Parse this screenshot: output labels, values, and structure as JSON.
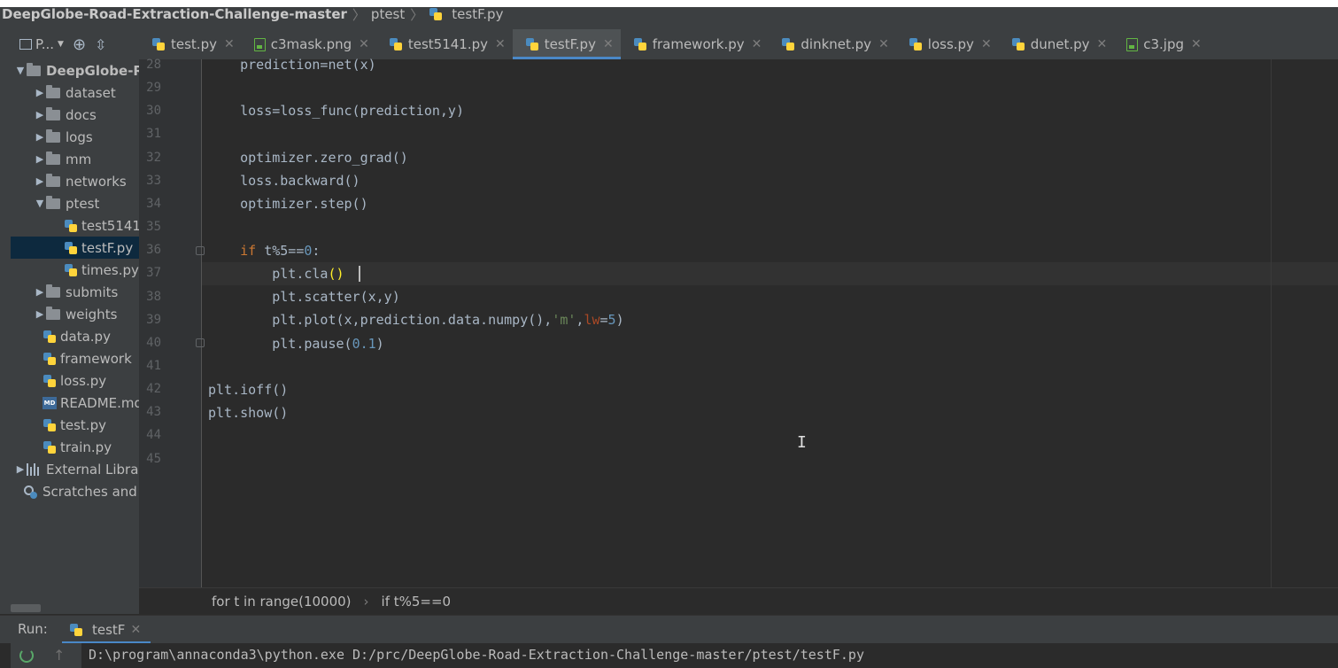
{
  "breadcrumb": {
    "project": "DeepGlobe-Road-Extraction-Challenge-master",
    "folder": "ptest",
    "file": "testF.py"
  },
  "project_panel": {
    "title": "P...",
    "tree": [
      {
        "label": "DeepGlobe-R",
        "type": "folder",
        "expanded": true,
        "level": 0
      },
      {
        "label": "dataset",
        "type": "folder",
        "level": 1
      },
      {
        "label": "docs",
        "type": "folder",
        "level": 1
      },
      {
        "label": "logs",
        "type": "folder",
        "level": 1
      },
      {
        "label": "mm",
        "type": "folder",
        "level": 1
      },
      {
        "label": "networks",
        "type": "folder",
        "level": 1
      },
      {
        "label": "ptest",
        "type": "folder",
        "expanded": true,
        "level": 1
      },
      {
        "label": "test5141",
        "type": "py",
        "level": 2
      },
      {
        "label": "testF.py",
        "type": "py",
        "level": 2,
        "selected": true
      },
      {
        "label": "times.py",
        "type": "py",
        "level": 2
      },
      {
        "label": "submits",
        "type": "folder",
        "level": 1
      },
      {
        "label": "weights",
        "type": "folder",
        "level": 1
      },
      {
        "label": "data.py",
        "type": "py",
        "level": 1
      },
      {
        "label": "framework",
        "type": "py",
        "level": 1
      },
      {
        "label": "loss.py",
        "type": "py",
        "level": 1
      },
      {
        "label": "README.md",
        "type": "md",
        "level": 1
      },
      {
        "label": "test.py",
        "type": "py",
        "level": 1
      },
      {
        "label": "train.py",
        "type": "py",
        "level": 1
      },
      {
        "label": "External Libraries",
        "type": "lib",
        "level": 0
      },
      {
        "label": "Scratches and Consoles",
        "type": "scratch",
        "level": 0
      }
    ]
  },
  "tabs": [
    {
      "label": "test.py",
      "icon": "python-file-icon"
    },
    {
      "label": "c3mask.png",
      "icon": "image-file-icon"
    },
    {
      "label": "test5141.py",
      "icon": "python-file-icon"
    },
    {
      "label": "testF.py",
      "icon": "python-file-icon",
      "active": true
    },
    {
      "label": "framework.py",
      "icon": "python-file-icon"
    },
    {
      "label": "dinknet.py",
      "icon": "python-file-icon"
    },
    {
      "label": "loss.py",
      "icon": "python-file-icon"
    },
    {
      "label": "dunet.py",
      "icon": "python-file-icon"
    },
    {
      "label": "c3.jpg",
      "icon": "image-file-icon"
    }
  ],
  "editor": {
    "line_numbers": [
      "28",
      "29",
      "30",
      "31",
      "32",
      "33",
      "34",
      "35",
      "36",
      "37",
      "38",
      "39",
      "40",
      "41",
      "42",
      "43",
      "44",
      "45"
    ],
    "lines": {
      "l28": "    prediction=net(x)",
      "l30": "    loss=loss_func(prediction,y)",
      "l32": "    optimizer.zero_grad()",
      "l33": "    loss.backward()",
      "l34": "    optimizer.step()",
      "l36_kw": "if",
      "l36_rest": " t%5==",
      "l36_num": "0",
      "l36_end": ":",
      "l37_a": "plt.cla",
      "l37_b": "()",
      "l38": "plt.scatter(x,y)",
      "l39_a": "plt.plot(x,prediction.data.numpy(),",
      "l39_str": "'m'",
      "l39_comma": ",",
      "l39_prm": "lw",
      "l39_eq": "=",
      "l39_num": "5",
      "l39_end": ")",
      "l40_a": "plt.pause(",
      "l40_num": "0.1",
      "l40_end": ")",
      "l42": "plt.ioff()",
      "l43": "plt.show()"
    }
  },
  "editor_breadcrumb": {
    "first": "for t in range(10000)",
    "second": "if t%5==0"
  },
  "run": {
    "label": "Run:",
    "tab": "testF",
    "console_line": "D:\\program\\annaconda3\\python.exe D:/prc/DeepGlobe-Road-Extraction-Challenge-master/ptest/testF.py"
  }
}
